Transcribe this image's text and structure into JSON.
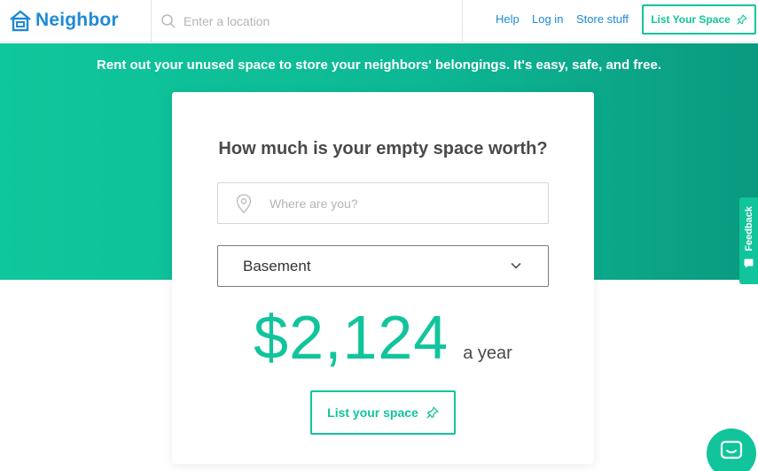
{
  "brand": {
    "name": "Neighbor",
    "logo_icon": "house-logo-icon",
    "color": "#1f8ad4"
  },
  "header": {
    "search_icon": "search-icon",
    "search_placeholder": "Enter a location",
    "nav": {
      "help": "Help",
      "login": "Log in",
      "store": "Store stuff"
    },
    "cta_label": "List Your Space",
    "cta_icon": "pin-icon"
  },
  "hero": {
    "tagline": "Rent out your unused space to store your neighbors' belongings. It's easy, safe, and free.",
    "color": "#0fc79c"
  },
  "card": {
    "title": "How much is your empty space worth?",
    "location_placeholder": "Where are you?",
    "location_icon": "map-pin-icon",
    "space_type": "Basement",
    "price": "$2,124",
    "price_suffix": "a year",
    "cta_label": "List your space"
  },
  "feedback": {
    "label": "Feedback"
  },
  "colors": {
    "accent": "#12c49b",
    "link": "#1f8ad4",
    "text": "#4a4a4a"
  }
}
